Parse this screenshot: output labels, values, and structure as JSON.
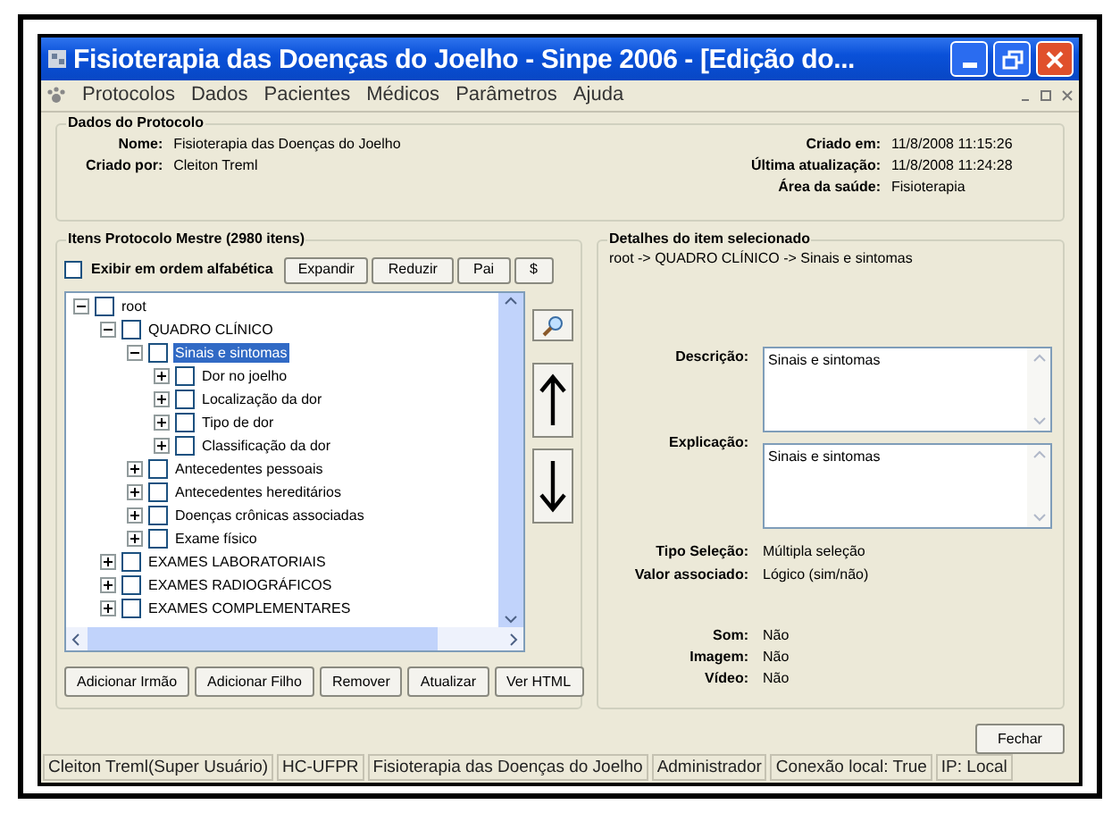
{
  "window": {
    "title": "Fisioterapia das Doenças do Joelho - Sinpe 2006 - [Edição do..."
  },
  "menu": [
    "Protocolos",
    "Dados",
    "Pacientes",
    "Médicos",
    "Parâmetros",
    "Ajuda"
  ],
  "protocol": {
    "title": "Dados do Protocolo",
    "left_fields": [
      {
        "label": "Nome:",
        "value": "Fisioterapia das Doenças do Joelho"
      },
      {
        "label": "Criado por:",
        "value": "Cleiton Treml"
      }
    ],
    "right_fields": [
      {
        "label": "Criado em:",
        "value": "11/8/2008 11:15:26"
      },
      {
        "label": "Última atualização:",
        "value": "11/8/2008 11:24:28"
      },
      {
        "label": "Área da saúde:",
        "value": "Fisioterapia"
      }
    ]
  },
  "items_panel": {
    "title": "Itens Protocolo Mestre (2980 itens)",
    "alphabetical": {
      "label": "Exibir em ordem alfabética",
      "checked": false
    },
    "tool_buttons": [
      "Expandir",
      "Reduzir",
      "Pai",
      "$"
    ],
    "tree": [
      {
        "label": "root",
        "checked": false,
        "selected": false,
        "expanded": true,
        "children": [
          {
            "label": "QUADRO CLÍNICO",
            "checked": false,
            "selected": false,
            "expanded": true,
            "children": [
              {
                "label": "Sinais e sintomas",
                "checked": false,
                "selected": true,
                "expanded": true,
                "children": [
                  {
                    "label": "Dor no joelho",
                    "checked": false,
                    "selected": false,
                    "expanded": false
                  },
                  {
                    "label": "Localização da dor",
                    "checked": false,
                    "selected": false,
                    "expanded": false
                  },
                  {
                    "label": "Tipo de dor",
                    "checked": false,
                    "selected": false,
                    "expanded": false
                  },
                  {
                    "label": "Classificação da dor",
                    "checked": false,
                    "selected": false,
                    "expanded": false
                  }
                ]
              },
              {
                "label": "Antecedentes pessoais",
                "checked": false,
                "selected": false,
                "expanded": false
              },
              {
                "label": "Antecedentes hereditários",
                "checked": false,
                "selected": false,
                "expanded": false
              },
              {
                "label": "Doenças crônicas associadas",
                "checked": false,
                "selected": false,
                "expanded": false
              },
              {
                "label": "Exame físico",
                "checked": false,
                "selected": false,
                "expanded": false
              }
            ]
          },
          {
            "label": "EXAMES LABORATORIAIS",
            "checked": false,
            "selected": false,
            "expanded": false
          },
          {
            "label": "EXAMES RADIOGRÁFICOS",
            "checked": false,
            "selected": false,
            "expanded": false
          },
          {
            "label": "EXAMES COMPLEMENTARES",
            "checked": false,
            "selected": false,
            "expanded": false
          }
        ]
      }
    ],
    "action_buttons": [
      "Adicionar Irmão",
      "Adicionar Filho",
      "Remover",
      "Atualizar",
      "Ver HTML"
    ]
  },
  "details": {
    "title": "Detalhes do item selecionado",
    "path": "root -> QUADRO CLÍNICO -> Sinais e sintomas",
    "text_fields": [
      {
        "label": "Descrição:",
        "value": "Sinais e sintomas"
      },
      {
        "label": "Explicação:",
        "value": "Sinais e sintomas"
      }
    ],
    "selection_fields": [
      {
        "label": "Tipo Seleção:",
        "value": "Múltipla seleção"
      },
      {
        "label": "Valor associado:",
        "value": "Lógico (sim/não)"
      }
    ],
    "media_fields": [
      {
        "label": "Som:",
        "value": "Não"
      },
      {
        "label": "Imagem:",
        "value": "Não"
      },
      {
        "label": "Vídeo:",
        "value": "Não"
      }
    ]
  },
  "close_button": "Fechar",
  "status_bar": [
    "Cleiton Treml(Super Usuário)",
    "HC-UFPR",
    "Fisioterapia das Doenças do Joelho",
    "Administrador",
    "Conexão local: True",
    "IP: Local"
  ]
}
